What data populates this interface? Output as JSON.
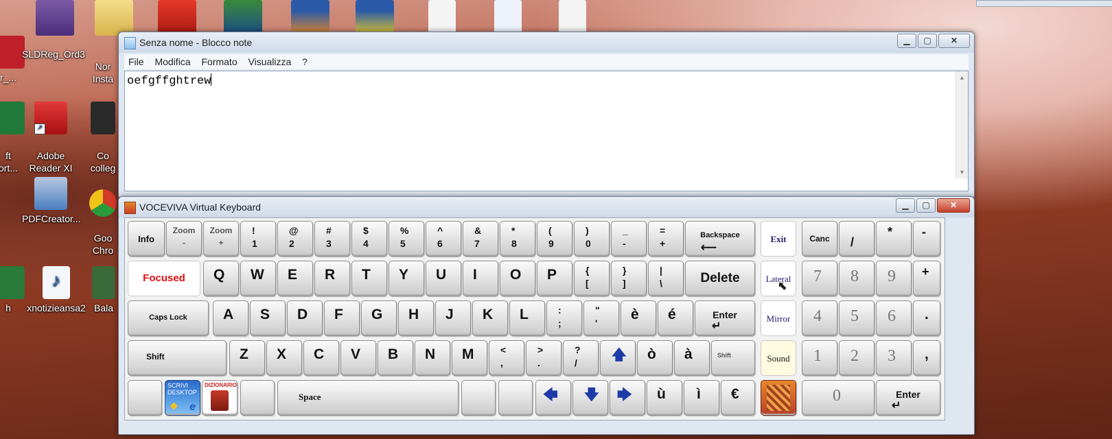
{
  "desktop": {
    "icons": [
      {
        "label": "r_...",
        "color": "#c0202a"
      },
      {
        "label": "SLDReg_Ord3",
        "color": "#6b4fa8"
      },
      {
        "label": "Nor\nInsta",
        "color": "#e5c24a"
      },
      {
        "label": "ft\nort...",
        "color": "#1f7a3a"
      },
      {
        "label": "Adobe\nReader XI",
        "color": "#c81e1e"
      },
      {
        "label": "Co\ncolleg",
        "color": "#2a2a2a"
      },
      {
        "label": "PDFCreator...",
        "color": "#4a7fc0"
      },
      {
        "label": "Goo\nChro",
        "color": "#d23a2a"
      },
      {
        "label": "h",
        "color": "#2a7a3a"
      },
      {
        "label": "xnotizieansa2",
        "color": "#ffffff"
      },
      {
        "label": "Bala",
        "color": "#3a6a3a"
      }
    ]
  },
  "notepad": {
    "title": "Senza nome - Blocco note",
    "menu": [
      "File",
      "Modifica",
      "Formato",
      "Visualizza",
      "?"
    ],
    "content": "oefgffghtrew"
  },
  "keyboard": {
    "title": "VOCEVIVA Virtual Keyboard",
    "keys": {
      "info": "Info",
      "zoom_minus_top": "Zoom",
      "zoom_minus_bot": "-",
      "zoom_plus_top": "Zoom",
      "zoom_plus_bot": "+",
      "row1": [
        [
          "!",
          "1"
        ],
        [
          "@",
          "2"
        ],
        [
          "#",
          "3"
        ],
        [
          "$",
          "4"
        ],
        [
          "%",
          "5"
        ],
        [
          "^",
          "6"
        ],
        [
          "&",
          "7"
        ],
        [
          "*",
          "8"
        ],
        [
          "(",
          "9"
        ],
        [
          ")",
          "0"
        ],
        [
          "_",
          "-"
        ],
        [
          "=",
          "+"
        ]
      ],
      "backspace": "Backspace",
      "exit": "Exit",
      "canc": "Canc",
      "slash": "/",
      "star": "*",
      "minus": "-",
      "focused": "Focused",
      "row2": [
        "Q",
        "W",
        "E",
        "R",
        "T",
        "Y",
        "U",
        "I",
        "O",
        "P"
      ],
      "row2_sym": [
        [
          "{",
          "["
        ],
        [
          "}",
          "]"
        ],
        [
          "|",
          "\\"
        ]
      ],
      "delete": "Delete",
      "lateral": "Lateral",
      "num789": [
        "7",
        "8",
        "9"
      ],
      "plus": "+",
      "caps": "Caps Lock",
      "row3": [
        "A",
        "S",
        "D",
        "F",
        "G",
        "H",
        "J",
        "K",
        "L"
      ],
      "row3_sym": [
        [
          ":",
          ";"
        ],
        [
          "\"",
          "'"
        ]
      ],
      "e_grave": "è",
      "e_acute": "é",
      "enter": "Enter",
      "mirror": "Mirror",
      "num456": [
        "4",
        "5",
        "6"
      ],
      "dot": ".",
      "shift": "Shift",
      "row4": [
        "Z",
        "X",
        "C",
        "V",
        "B",
        "N",
        "M"
      ],
      "row4_sym": [
        [
          "<",
          ","
        ],
        [
          ">",
          "."
        ],
        [
          "?",
          "/"
        ]
      ],
      "o_grave": "ò",
      "a_grave": "à",
      "shift_small": "Shift",
      "sound": "Sound",
      "num123": [
        "1",
        "2",
        "3"
      ],
      "comma": ",",
      "scrivi": "SCRIVI DESKTOP",
      "dizionario": "DIZIONARIO",
      "space": "Space",
      "u_grave": "ù",
      "i_grave": "ì",
      "euro": "€",
      "zero": "0",
      "enter2": "Enter"
    }
  }
}
